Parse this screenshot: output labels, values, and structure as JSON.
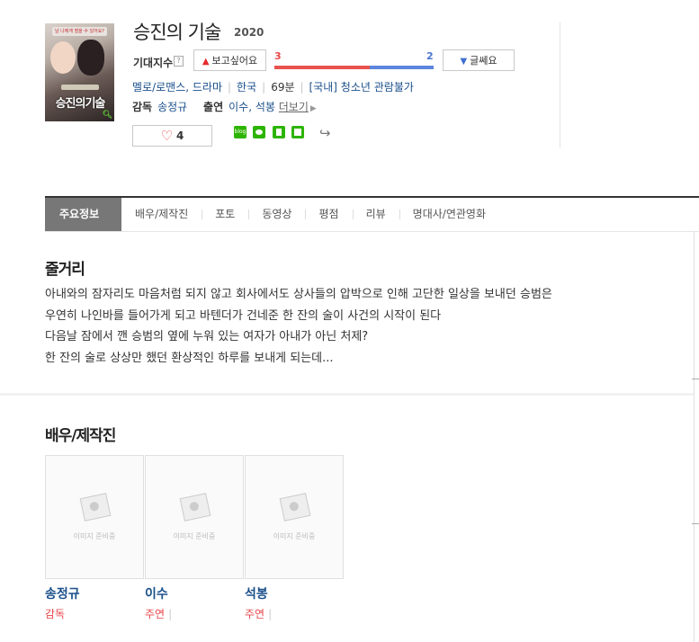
{
  "movie": {
    "title": "승진의 기술",
    "year": "2020",
    "poster": {
      "top_text": "남 나에게 벌을 수 있어요?",
      "title_text": "승진의기술"
    },
    "expect_label": "기대지수",
    "help_mark": "?",
    "want_label": "보고싶어요",
    "doubt_label": "글쎄요",
    "want_count": "3",
    "doubt_count": "2",
    "want_ratio": 0.6,
    "genre": "멜로/로맨스, 드라마",
    "country": "한국",
    "runtime": "69분",
    "rating": "[국내] 청소년 관람불가",
    "director_label": "감독",
    "director": "송정규",
    "cast_label": "출연",
    "cast": "이수, 석봉",
    "more_label": "더보기",
    "likes": "4",
    "share_blog_text": "blog"
  },
  "tabs": [
    "주요정보",
    "배우/제작진",
    "포토",
    "동영상",
    "평점",
    "리뷰",
    "명대사/연관영화"
  ],
  "plot": {
    "heading": "줄거리",
    "lines": [
      "아내와의 잠자리도 마음처럼 되지 않고 회사에서도 상사들의 압박으로 인해 고단한 일상을 보내던 승범은",
      " 우연히 나인바를 들어가게 되고 바텐더가 건네준 한 잔의 술이 사건의 시작이 된다",
      " 다음날 잠에서 깬 승범의 옆에 누워 있는 여자가 아내가 아닌 처제?",
      " 한 잔의 술로 상상만 했던 환상적인 하루를 보내게 되는데..."
    ]
  },
  "crew": {
    "heading": "배우/제작진",
    "placeholder": "이미지 준비중",
    "people": [
      {
        "name": "송정규",
        "role": "감독",
        "sep": ""
      },
      {
        "name": "이수",
        "role": "주연",
        "sep": "|"
      },
      {
        "name": "석봉",
        "role": "주연",
        "sep": "|"
      }
    ]
  },
  "colors": {
    "link": "#1a4f8b",
    "accent_red": "#e8474a",
    "accent_blue": "#4a76d3",
    "tab_active": "#777777"
  }
}
